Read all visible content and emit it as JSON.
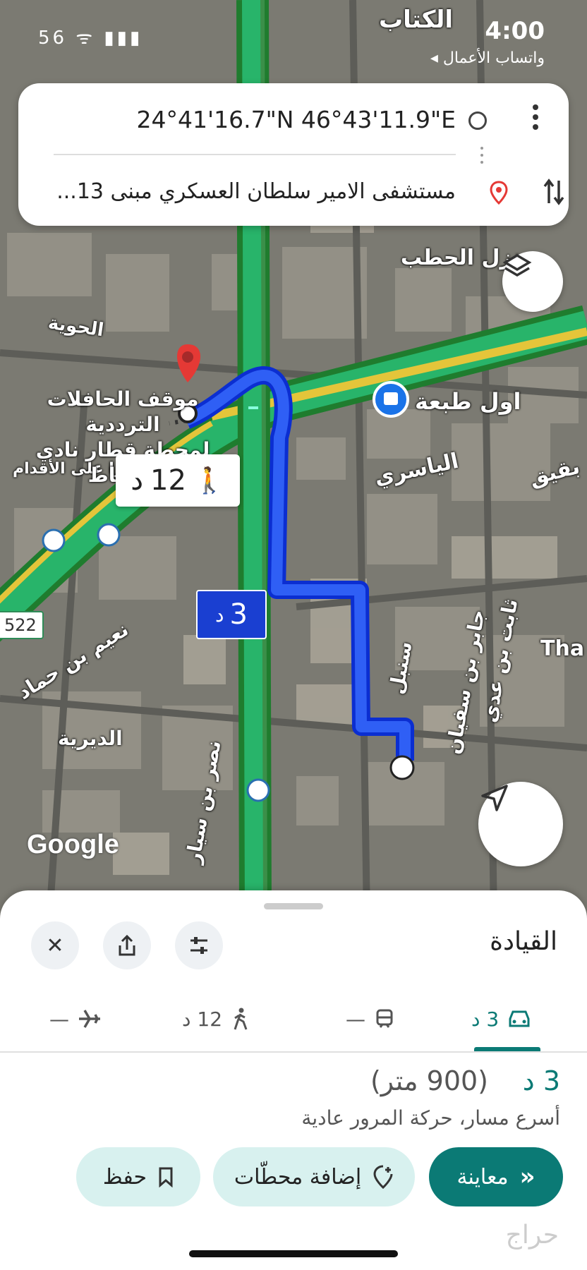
{
  "status_bar": {
    "time": "4:00",
    "back_label": "◂ واتساب الأعمال",
    "signal_icons": "56 ᯤ ▮▮▮"
  },
  "search_card": {
    "origin": "24°41'16.7\"N 46°43'11.9\"E",
    "destination": "مستشفى الامير سلطان العسكري مبنى 13..."
  },
  "map": {
    "labels": {
      "top_right": "الكتاب",
      "hatab": "منزل الحطب",
      "hawiya": "الحوية",
      "awal_tabea": "اول طبعة",
      "yasiri": "الياسري",
      "bqiq": "بقيق",
      "naeem": "نعيم بن حماد",
      "diriya": "الديرية",
      "nasr": "نصر بن سيار",
      "jaber": "جابر بن سفيان",
      "thabit": "ثابت بن عدي",
      "sunbul": "سنبل",
      "tha": "Tha",
      "walking_hint": "سيرًا على الأقدام"
    },
    "destination_label_1": "موقف الحافلات الترددية",
    "destination_label_2": "لمحطة قطار نادي الضباط",
    "walk_label": {
      "value": "12",
      "unit": "د"
    },
    "drive_label": {
      "value": "3",
      "unit": "د"
    },
    "road_shield": "522",
    "google_logo": "Google",
    "route_color": "#1a3fd1"
  },
  "sheet": {
    "title": "القيادة",
    "modes": [
      {
        "label": "3 د",
        "icon": "car-icon",
        "active": true
      },
      {
        "label": "—",
        "icon": "train-icon",
        "active": false
      },
      {
        "label": "12 د",
        "icon": "walk-icon",
        "active": false
      },
      {
        "label": "—",
        "icon": "plane-icon",
        "active": false
      }
    ],
    "summary": {
      "time": "3 د",
      "distance": "(900 متر)",
      "subtitle": "أسرع مسار، حركة المرور عادية"
    },
    "actions": {
      "preview": "معاينة",
      "add_stops": "إضافة محطّات",
      "save": "حفظ"
    },
    "accent": "#0b7a75"
  },
  "watermark": "حراج"
}
